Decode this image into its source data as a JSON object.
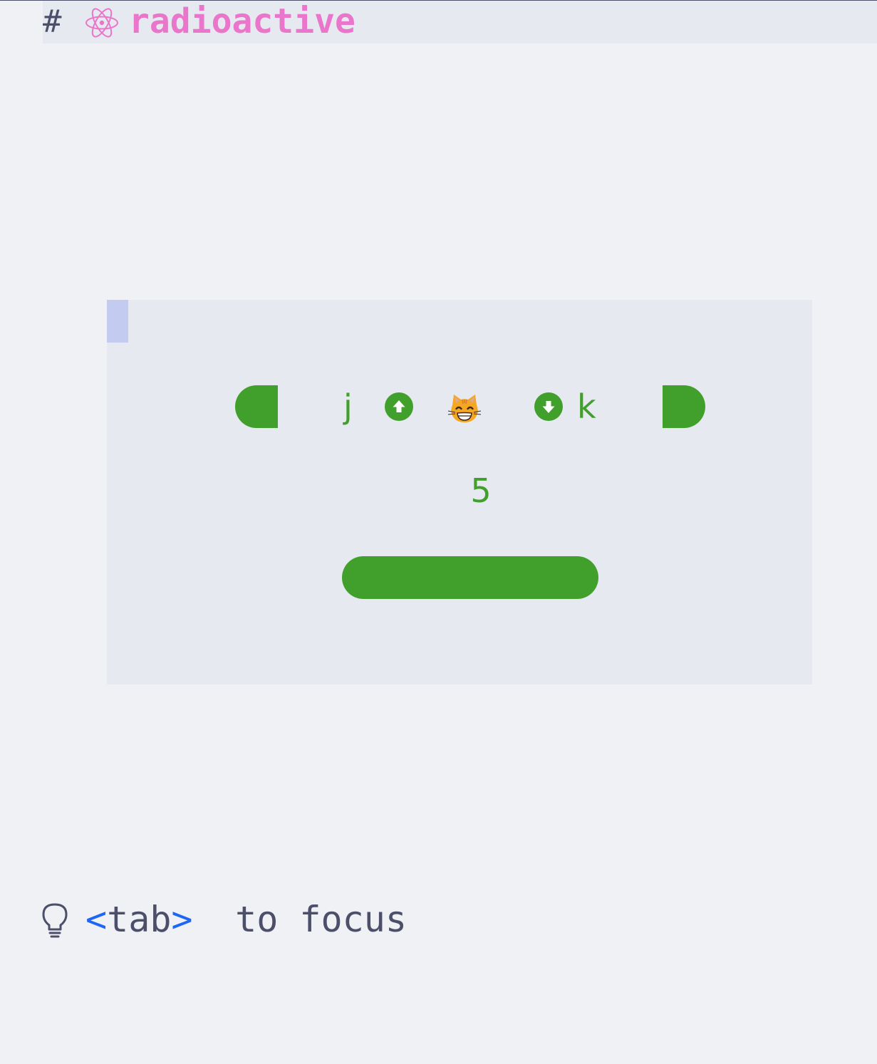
{
  "header": {
    "hash": "#",
    "icon": "atom-icon",
    "title": "radioactive"
  },
  "panel": {
    "left_key": "j",
    "up_icon": "arrow-up-circle-icon",
    "face_icon": "grinning-cat-emoji",
    "down_icon": "arrow-down-circle-icon",
    "right_key": "k",
    "count": "5"
  },
  "hint": {
    "icon": "lightbulb-icon",
    "open": "<",
    "key": "tab",
    "close": ">",
    "text": " to focus"
  },
  "colors": {
    "background": "#eff1f5",
    "panel": "#e6e9ef",
    "accent": "#40a02b",
    "title": "#ea76cb",
    "cursor": "#c3cbf1",
    "key_bracket": "#1e66f5",
    "text": "#4c4f69"
  }
}
